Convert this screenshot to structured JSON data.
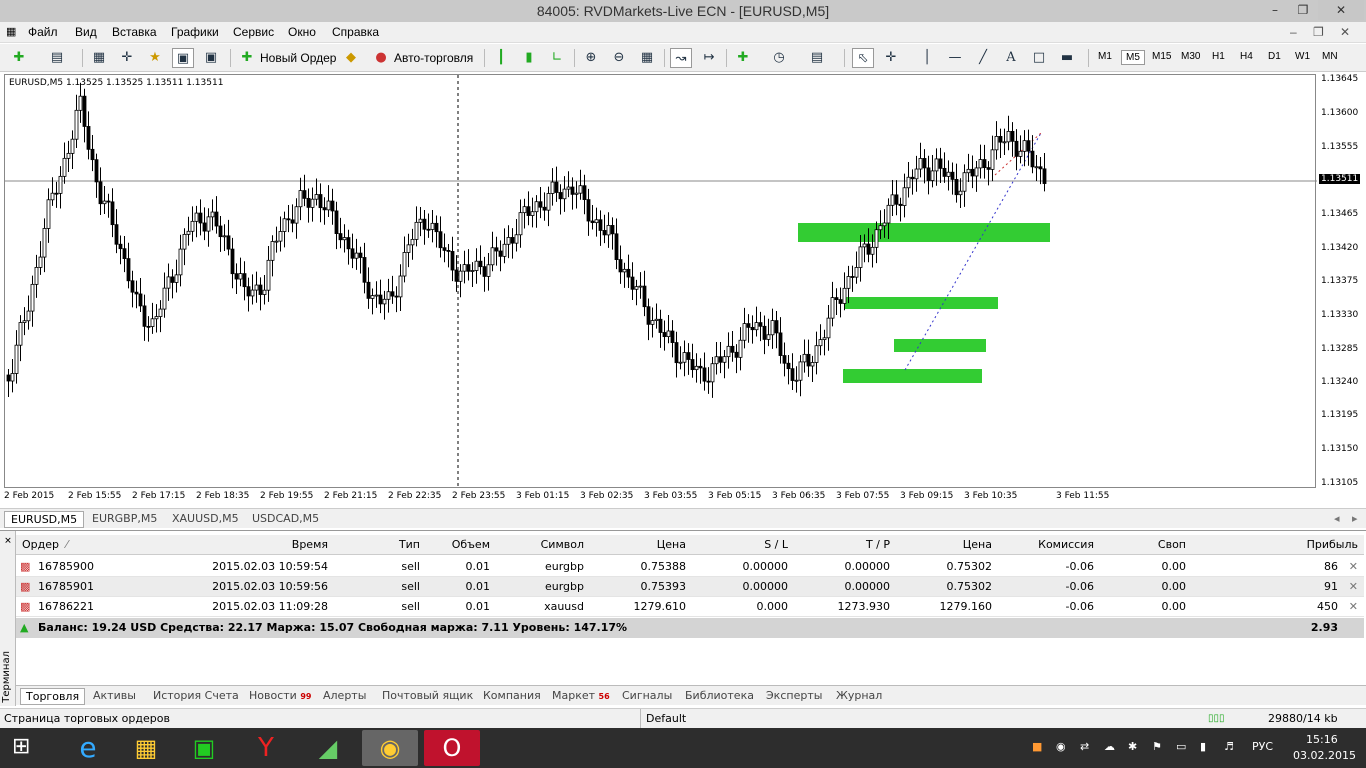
{
  "window": {
    "title": "84005: RVDMarkets-Live ECN - [EURUSD,M5]"
  },
  "menu": [
    "Файл",
    "Вид",
    "Вставка",
    "Графики",
    "Сервис",
    "Окно",
    "Справка"
  ],
  "toolbar": {
    "new_order": "Новый Ордер",
    "auto_trading": "Авто-торговля",
    "timeframes": [
      "M1",
      "M5",
      "M15",
      "M30",
      "H1",
      "H4",
      "D1",
      "W1",
      "MN"
    ],
    "active_timeframe": "M5"
  },
  "chart": {
    "header": "EURUSD,M5  1.13525 1.13525 1.13511 1.13511",
    "current_price": "1.13511",
    "y_ticks": [
      "1.13645",
      "1.13600",
      "1.13555",
      "1.13510",
      "1.13465",
      "1.13420",
      "1.13375",
      "1.13330",
      "1.13285",
      "1.13240",
      "1.13195",
      "1.13150",
      "1.13105"
    ],
    "x_ticks": [
      "2 Feb 2015",
      "2 Feb 15:55",
      "2 Feb 17:15",
      "2 Feb 18:35",
      "2 Feb 19:55",
      "2 Feb 21:15",
      "2 Feb 22:35",
      "2 Feb 23:55",
      "3 Feb 01:15",
      "3 Feb 02:35",
      "3 Feb 03:55",
      "3 Feb 05:15",
      "3 Feb 06:35",
      "3 Feb 07:55",
      "3 Feb 09:15",
      "3 Feb 10:35",
      "3 Feb 11:55"
    ],
    "colors": {
      "zone": "#33cc33",
      "candle": "#000000",
      "grid_line": "#888888"
    }
  },
  "chart_tabs": [
    "EURUSD,M5",
    "EURGBP,M5",
    "XAUUSD,M5",
    "USDCAD,M5"
  ],
  "terminal": {
    "side_label": "Терминал",
    "columns": [
      "Ордер",
      "Время",
      "Тип",
      "Объем",
      "Символ",
      "Цена",
      "S / L",
      "T / P",
      "Цена",
      "Комиссия",
      "Своп",
      "Прибыль"
    ],
    "rows": [
      [
        "16785900",
        "2015.02.03 10:59:54",
        "sell",
        "0.01",
        "eurgbp",
        "0.75388",
        "0.00000",
        "0.00000",
        "0.75302",
        "-0.06",
        "0.00",
        "86"
      ],
      [
        "16785901",
        "2015.02.03 10:59:56",
        "sell",
        "0.01",
        "eurgbp",
        "0.75393",
        "0.00000",
        "0.00000",
        "0.75302",
        "-0.06",
        "0.00",
        "91"
      ],
      [
        "16786221",
        "2015.02.03 11:09:28",
        "sell",
        "0.01",
        "xauusd",
        "1279.610",
        "0.000",
        "1273.930",
        "1279.160",
        "-0.06",
        "0.00",
        "450"
      ]
    ],
    "balance_text": "Баланс: 19.24 USD  Средства: 22.17  Маржа: 15.07  Свободная маржа: 7.11  Уровень: 147.17%",
    "balance_profit": "2.93",
    "tabs": [
      {
        "label": "Торговля",
        "badge": ""
      },
      {
        "label": "Активы",
        "badge": ""
      },
      {
        "label": "История Счета",
        "badge": ""
      },
      {
        "label": "Новости",
        "badge": "99"
      },
      {
        "label": "Алерты",
        "badge": ""
      },
      {
        "label": "Почтовый ящик",
        "badge": ""
      },
      {
        "label": "Компания",
        "badge": ""
      },
      {
        "label": "Маркет",
        "badge": "56"
      },
      {
        "label": "Сигналы",
        "badge": ""
      },
      {
        "label": "Библиотека",
        "badge": ""
      },
      {
        "label": "Эксперты",
        "badge": ""
      },
      {
        "label": "Журнал",
        "badge": ""
      }
    ]
  },
  "status": {
    "left": "Страница торговых ордеров",
    "profile": "Default",
    "traffic": "29880/14 kb"
  },
  "taskbar": {
    "language": "РУС",
    "time": "15:16",
    "date": "03.02.2015"
  }
}
